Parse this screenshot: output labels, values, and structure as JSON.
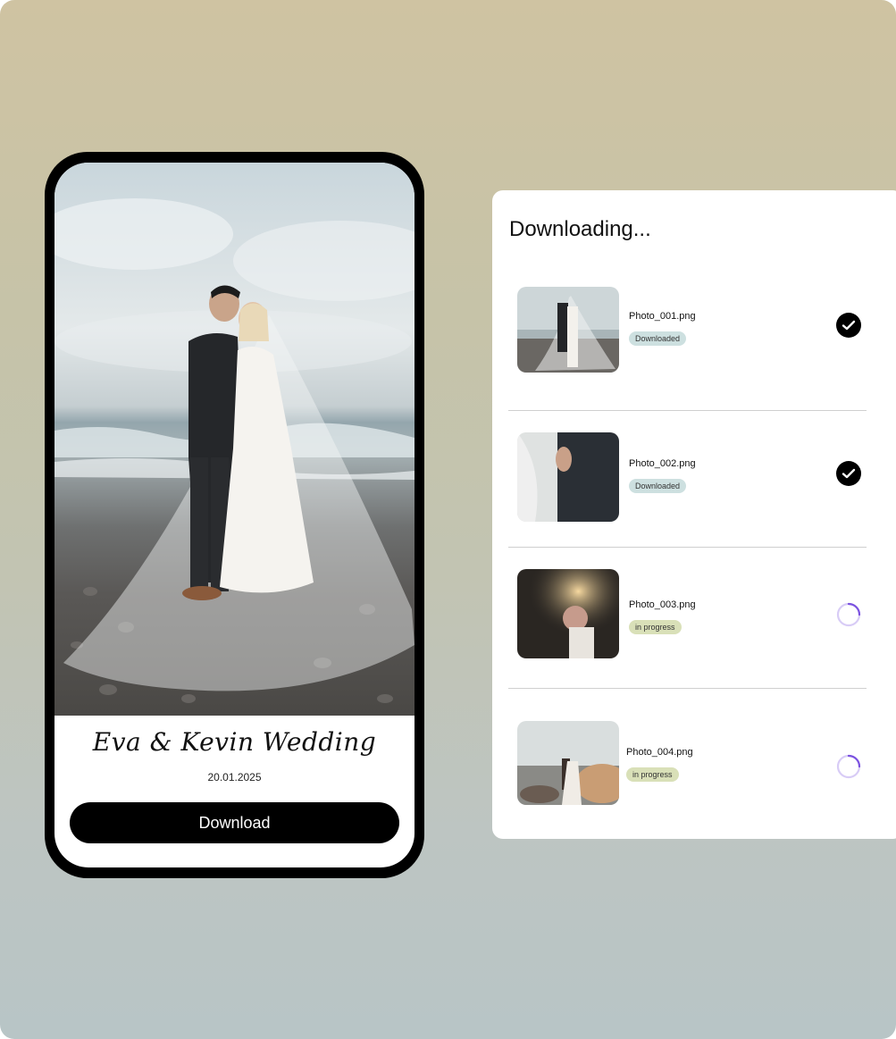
{
  "phone": {
    "wedding_title": "Eva & Kevin Wedding",
    "wedding_date": "20.01.2025",
    "download_button_label": "Download"
  },
  "panel": {
    "title": "Downloading...",
    "items": [
      {
        "filename": "Photo_001.png",
        "status": "Downloaded",
        "state": "complete",
        "icon": "check-icon"
      },
      {
        "filename": "Photo_002.png",
        "status": "Downloaded",
        "state": "complete",
        "icon": "check-icon"
      },
      {
        "filename": "Photo_003.png",
        "status": "in progress",
        "state": "loading",
        "icon": "spinner-icon"
      },
      {
        "filename": "Photo_004.png",
        "status": "in progress",
        "state": "loading",
        "icon": "spinner-icon"
      }
    ]
  },
  "colors": {
    "badge_downloaded": "#cde0e0",
    "badge_in_progress": "#d9e0b8",
    "spinner_accent": "#7b52e0",
    "button": "#000000"
  }
}
